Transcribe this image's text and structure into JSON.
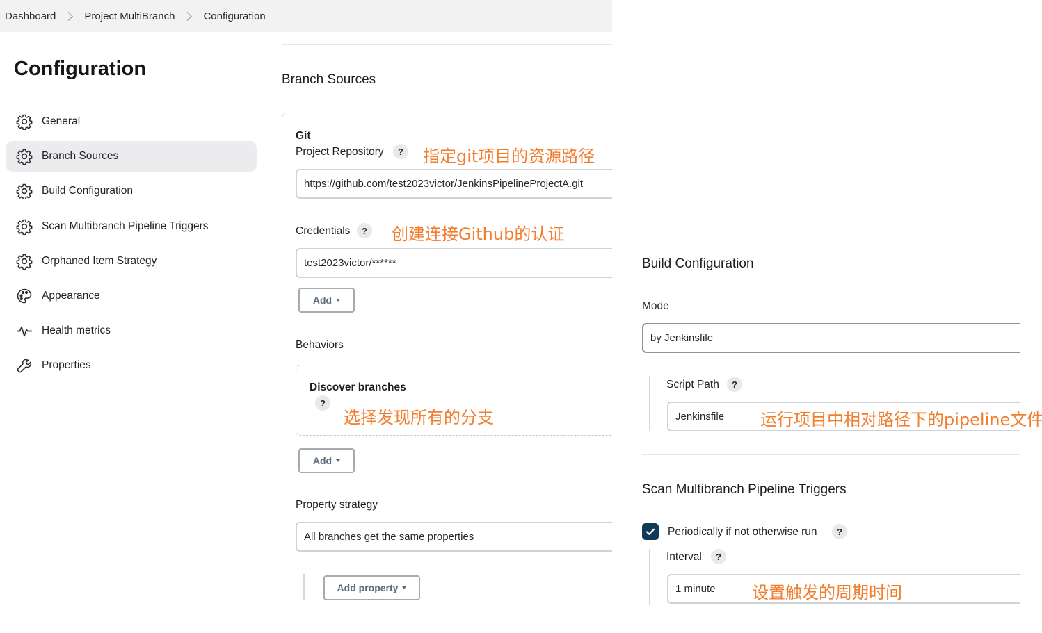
{
  "breadcrumb": {
    "items": [
      "Dashboard",
      "Project MultiBranch",
      "Configuration"
    ]
  },
  "page_title": "Configuration",
  "sidebar": {
    "items": [
      {
        "label": "General",
        "icon": "gear-icon"
      },
      {
        "label": "Branch Sources",
        "icon": "gear-icon",
        "active": true
      },
      {
        "label": "Build Configuration",
        "icon": "gear-icon"
      },
      {
        "label": "Scan Multibranch Pipeline Triggers",
        "icon": "gear-icon"
      },
      {
        "label": "Orphaned Item Strategy",
        "icon": "gear-icon"
      },
      {
        "label": "Appearance",
        "icon": "palette-icon"
      },
      {
        "label": "Health metrics",
        "icon": "pulse-icon"
      },
      {
        "label": "Properties",
        "icon": "wrench-icon"
      }
    ]
  },
  "branch_sources": {
    "title": "Branch Sources",
    "git_label": "Git",
    "repo_label": "Project Repository",
    "repo_value": "https://github.com/test2023victor/JenkinsPipelineProjectA.git",
    "repo_annotation": "指定git项目的资源路径",
    "credentials_label": "Credentials",
    "credentials_value": "test2023victor/******",
    "credentials_annotation": "创建连接Github的认证",
    "add_label": "Add",
    "behaviors_label": "Behaviors",
    "discover_label": "Discover branches",
    "discover_annotation": "选择发现所有的分支",
    "add_behavior_label": "Add",
    "property_strategy_label": "Property strategy",
    "property_strategy_value": "All branches get the same properties",
    "add_property_label": "Add property"
  },
  "build_configuration": {
    "title": "Build Configuration",
    "mode_label": "Mode",
    "mode_value": "by Jenkinsfile",
    "script_path_label": "Script Path",
    "script_path_value": "Jenkinsfile",
    "script_path_annotation": "运行项目中相对路径下的pipeline文件"
  },
  "scan_triggers": {
    "title": "Scan Multibranch Pipeline Triggers",
    "periodic_label": "Periodically if not otherwise run",
    "periodic_checked": true,
    "interval_label": "Interval",
    "interval_value": "1 minute",
    "interval_annotation": "设置触发的周期时间"
  },
  "help_symbol": "?",
  "colors": {
    "annotation": "#f27d2e",
    "checkbox": "#123a56",
    "active_bg": "#ececee"
  }
}
